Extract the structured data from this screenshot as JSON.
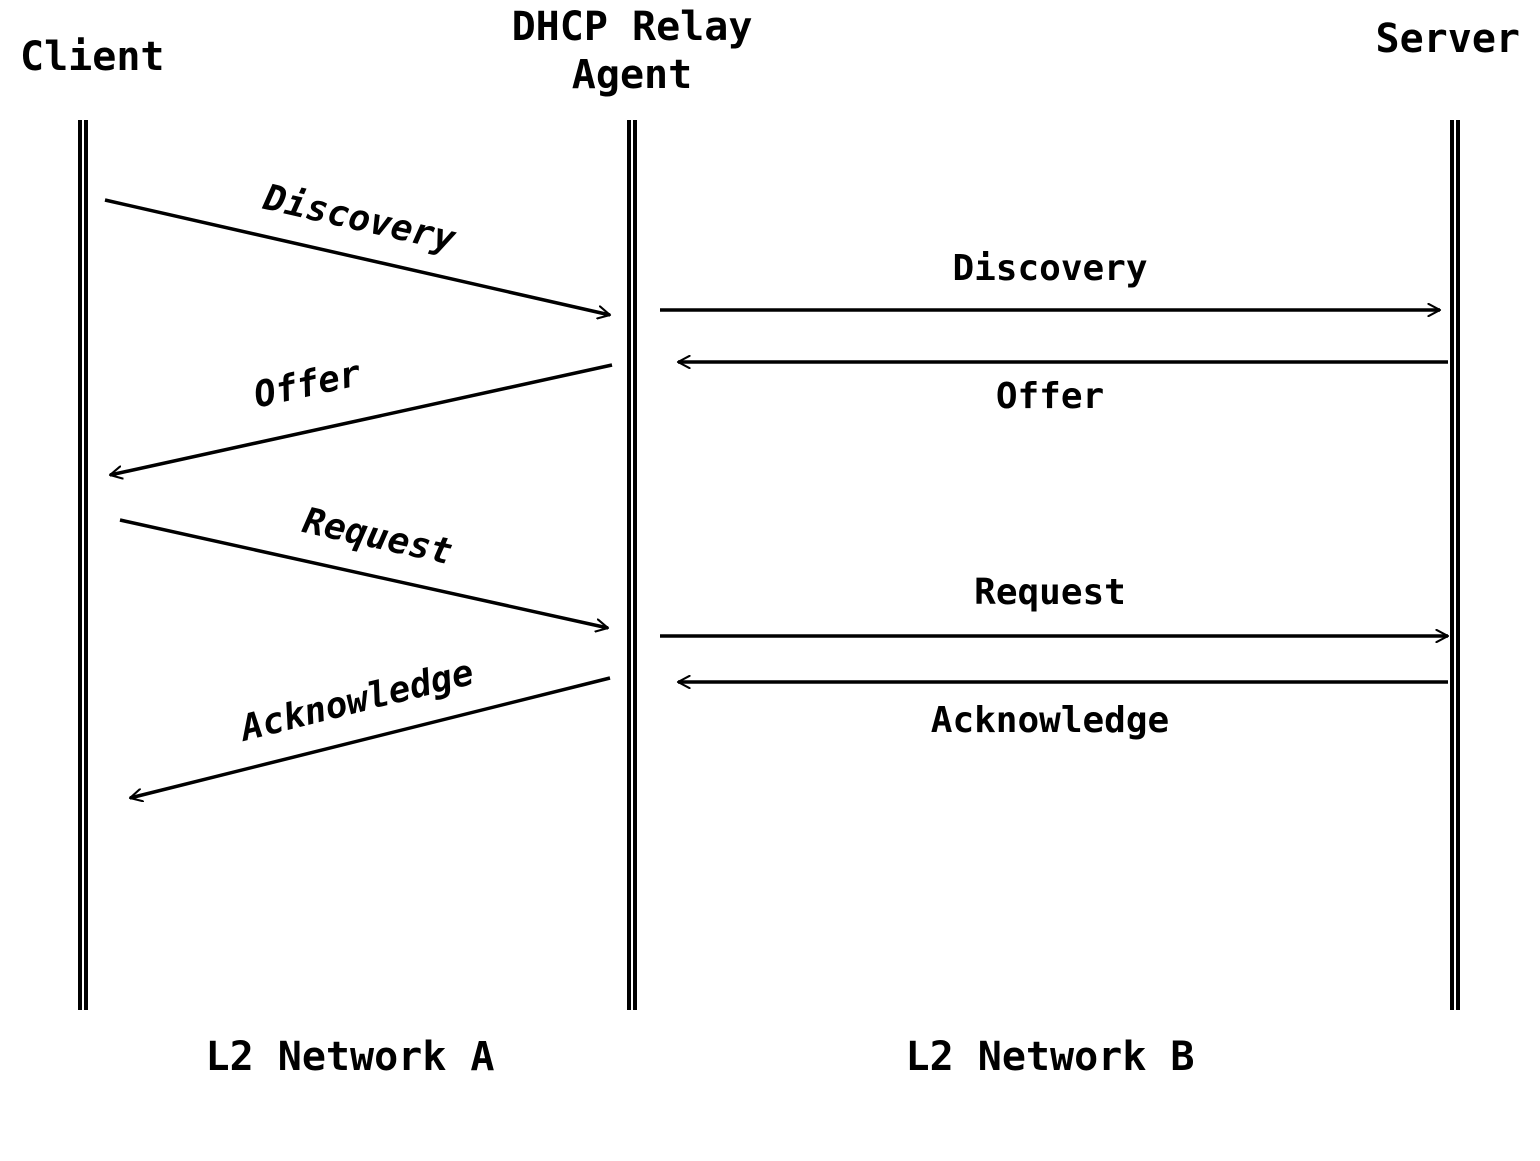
{
  "participants": {
    "client": "Client",
    "relay_line1": "DHCP Relay",
    "relay_line2": "Agent",
    "server": "Server"
  },
  "messages": {
    "left": {
      "discovery": "Discovery",
      "offer": "Offer",
      "request": "Request",
      "ack": "Acknowledge"
    },
    "right": {
      "discovery": "Discovery",
      "offer": "Offer",
      "request": "Request",
      "ack": "Acknowledge"
    }
  },
  "footers": {
    "net_a": "L2 Network A",
    "net_b": "L2 Network B"
  }
}
